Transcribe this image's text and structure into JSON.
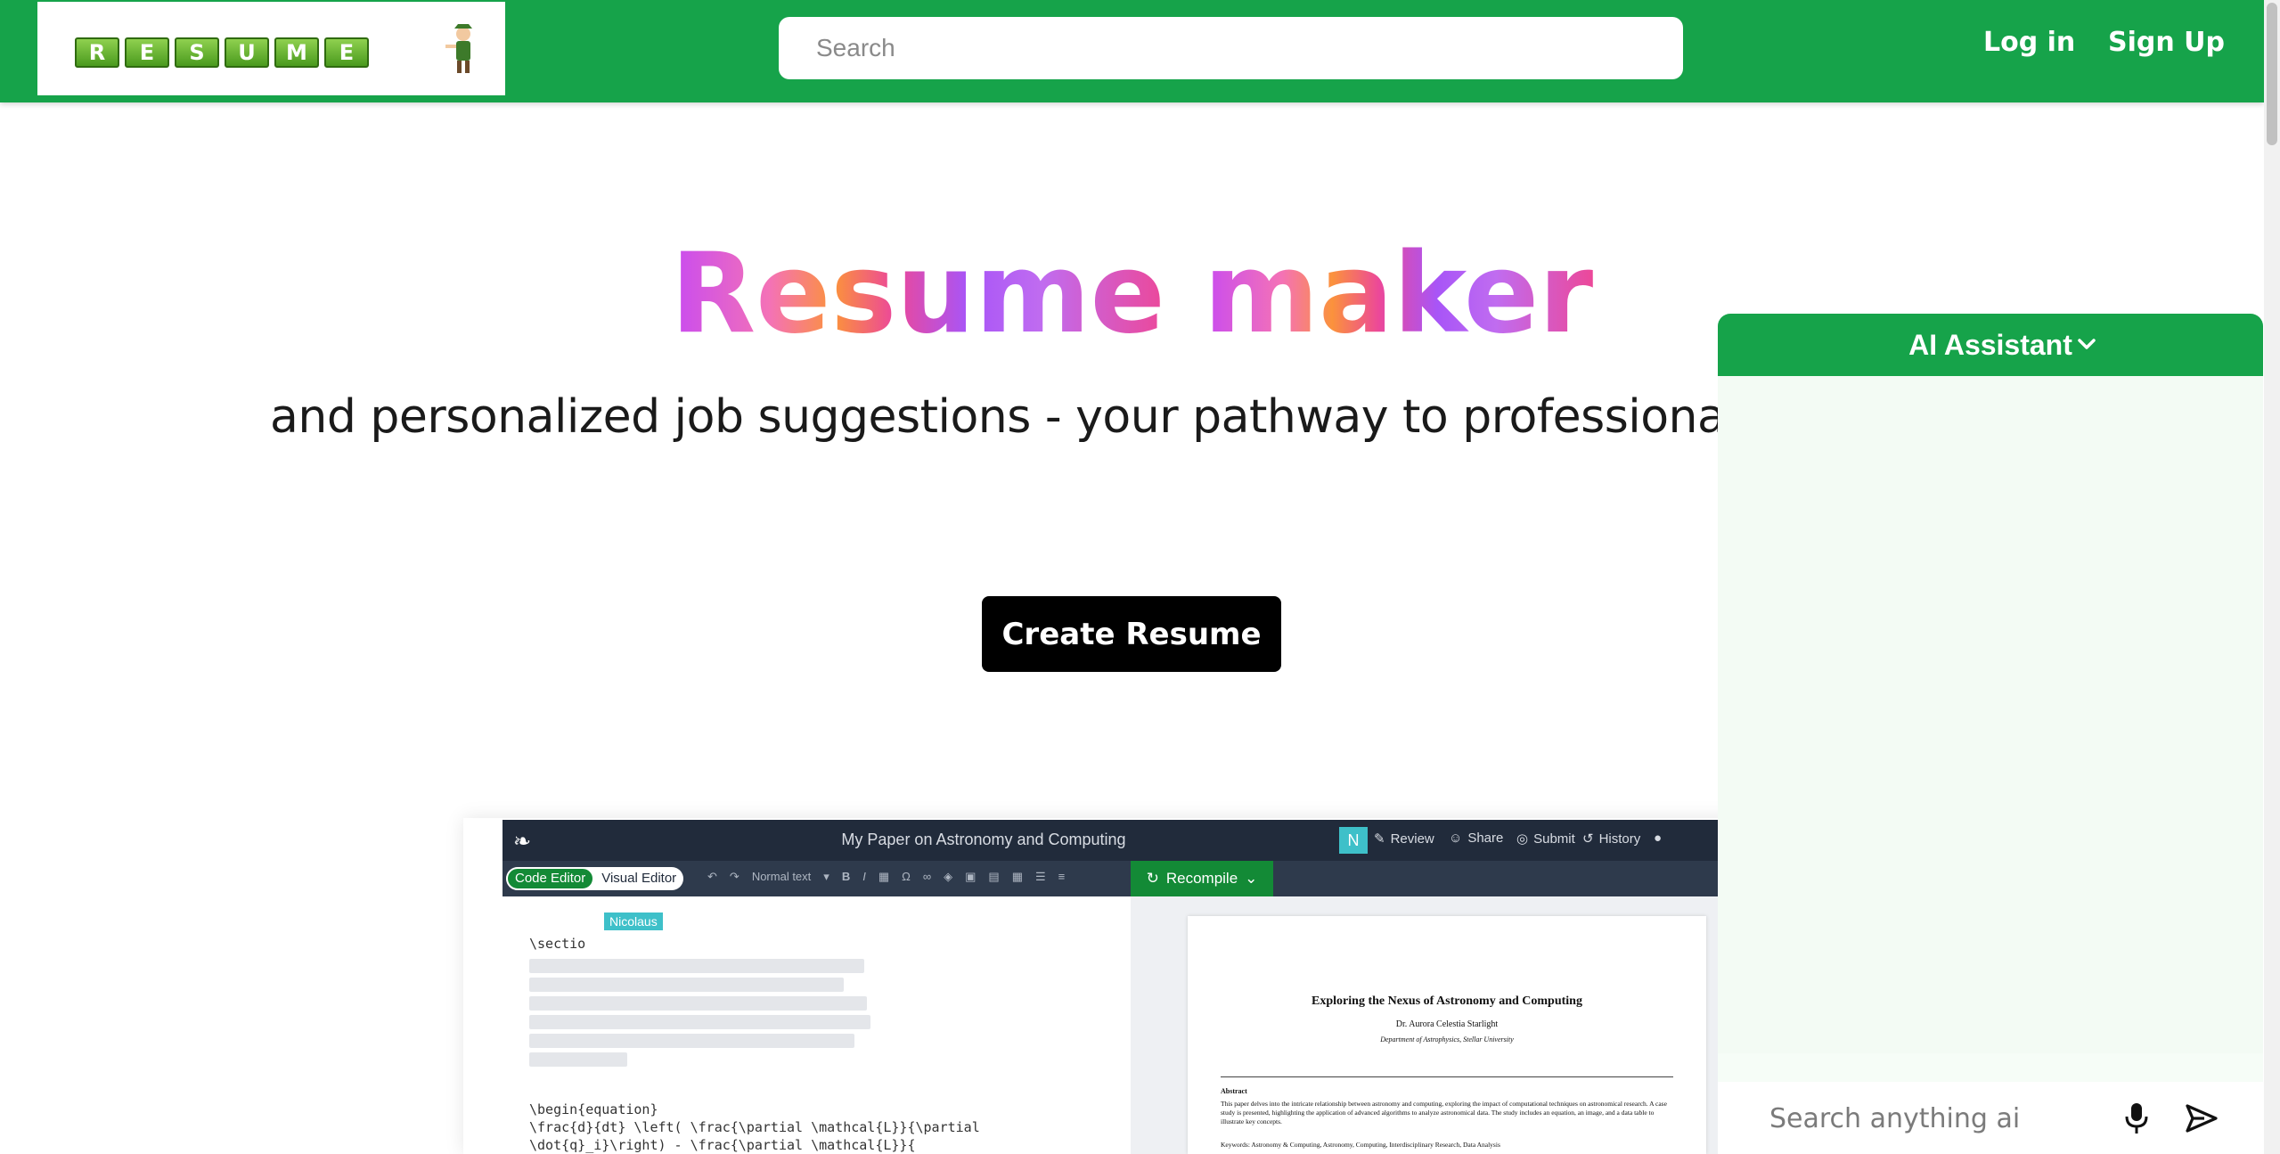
{
  "nav": {
    "logo_letters": [
      "R",
      "E",
      "S",
      "U",
      "M",
      "E"
    ],
    "search_placeholder": "Search",
    "login_label": "Log in",
    "signup_label": "Sign Up",
    "bg_color": "#16a34a"
  },
  "hero": {
    "title_word1": "Resume",
    "title_word2": "maker",
    "subtitle": "and personalized job suggestions - your pathway to professional succe",
    "cta_label": "Create Resume"
  },
  "editor": {
    "doc_title": "My Paper on Astronomy and Computing",
    "user_badge": "N",
    "actions": [
      {
        "icon": "review-icon",
        "label": "Review"
      },
      {
        "icon": "share-icon",
        "label": "Share"
      },
      {
        "icon": "submit-icon",
        "label": "Submit"
      },
      {
        "icon": "history-icon",
        "label": "History"
      }
    ],
    "mode_code": "Code Editor",
    "mode_visual": "Visual Editor",
    "text_style": "Normal text",
    "recompile_label": "Recompile",
    "cursor_user": "Nicolaus",
    "code_line1": "\\sectio",
    "code_begin": "\\begin{equation}",
    "code_l2": "\\frac{d}{dt} \\left( \\frac{\\partial \\mathcal{L}}{\\partial",
    "code_l3": "\\dot{q}_i}\\right) - \\frac{\\partial \\mathcal{L}}{",
    "pdf": {
      "title": "Exploring the Nexus of Astronomy and Computing",
      "author": "Dr. Aurora Celestia Starlight",
      "affiliation": "Department of Astrophysics, Stellar University",
      "abstract_heading": "Abstract",
      "abstract": "This paper delves into the intricate relationship between astronomy and computing, exploring the impact of computational techniques on astronomical research. A case study is presented, highlighting the application of advanced algorithms to analyze astronomical data. The study includes an equation, an image, and a data table to illustrate key concepts.",
      "keywords": "Keywords: Astronomy & Computing, Astronomy, Computing, Interdisciplinary Research, Data Analysis"
    }
  },
  "assistant": {
    "title": "AI Assistant",
    "input_placeholder": "Search anything ai will ans"
  }
}
